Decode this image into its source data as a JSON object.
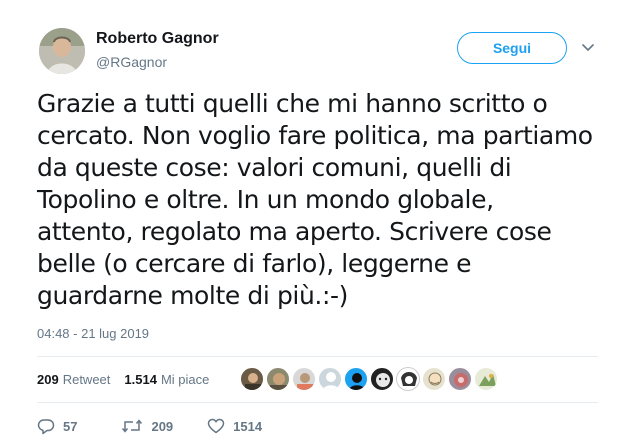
{
  "author": {
    "display_name": "Roberto Gagnor",
    "handle": "@RGagnor"
  },
  "follow_button": {
    "label": "Segui"
  },
  "tweet": {
    "lines": [
      "Grazie a tutti quelli che mi hanno scritto o",
      "cercato. Non voglio fare politica, ma partiamo",
      "da queste cose: valori comuni, quelli di",
      "Topolino e oltre. In un mondo globale,",
      "attento, regolato ma aperto. Scrivere cose",
      "belle (o cercare di farlo), leggerne e",
      "guardarne molte di più.:-)"
    ],
    "timestamp": "04:48 - 21 lug 2019"
  },
  "stats": {
    "retweets_count": "209",
    "retweets_label": "Retweet",
    "likes_count": "1.514",
    "likes_label": "Mi piace"
  },
  "actions": {
    "reply_count": "57",
    "retweet_count": "209",
    "like_count": "1514"
  },
  "icons": {
    "reply": "reply-icon",
    "retweet": "retweet-icon",
    "like": "heart-icon",
    "more": "chevron-down-icon"
  },
  "colors": {
    "accent": "#1da1f2",
    "text": "#14171a",
    "secondary": "#657786",
    "divider": "#e6ecf0"
  }
}
